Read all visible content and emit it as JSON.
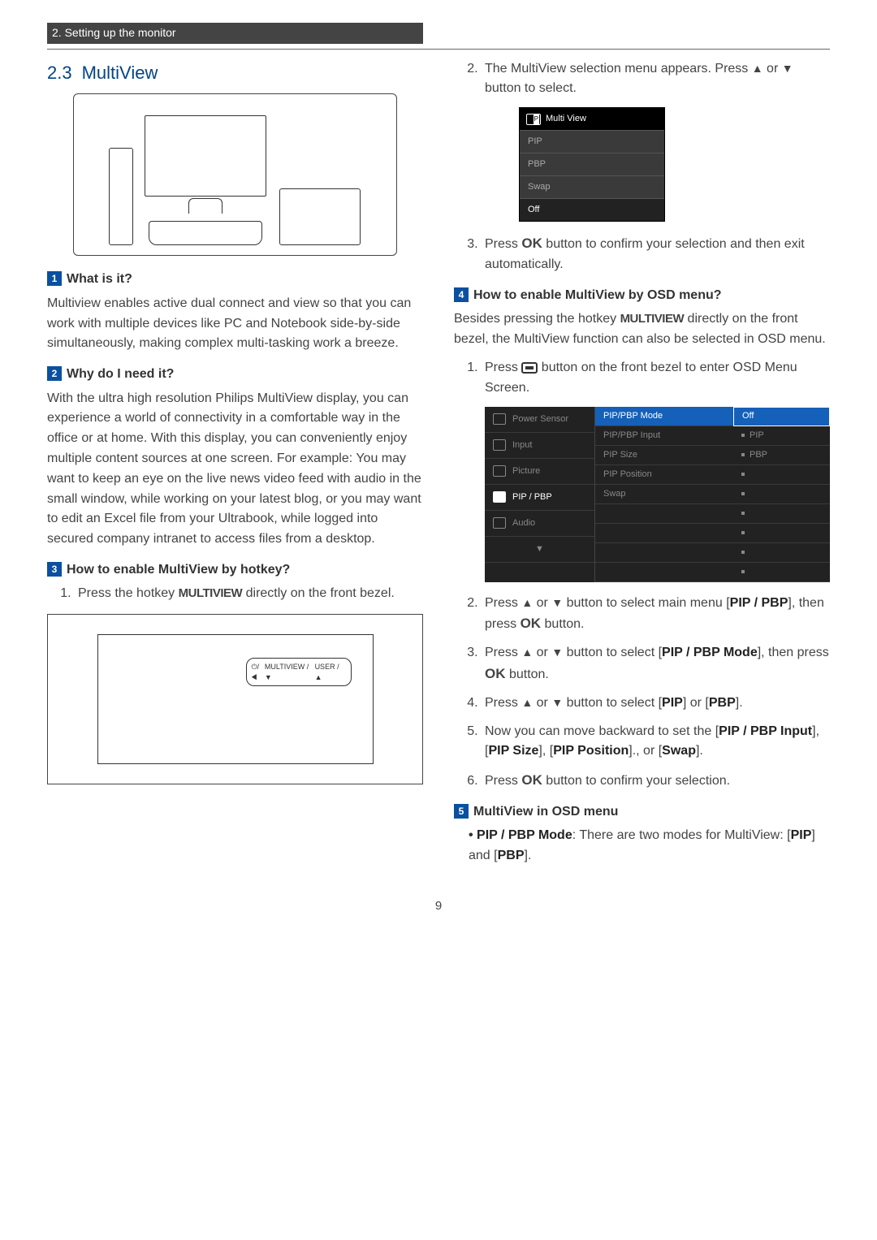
{
  "breadcrumb": {
    "num": "2.",
    "text": "Setting up the monitor"
  },
  "section": {
    "num": "2.3",
    "title": "MultiView"
  },
  "h1": {
    "num": "1",
    "title": "What is it?"
  },
  "p1": "Multiview enables active dual connect and view so that you can work with multiple devices like PC and Notebook side-by-side simultaneously, making complex multi-tasking work a breeze.",
  "h2": {
    "num": "2",
    "title": "Why do I need it?"
  },
  "p2": "With the ultra high resolution Philips MultiView display, you can experience a world of connectivity in a comfortable way in the office or at home. With this display, you can conveniently enjoy multiple content sources at one screen. For example: You may want to keep an eye on the live news video feed with audio in the small window, while working on your latest blog, or you may want to edit an Excel file from your Ultrabook, while logged into secured company intranet to access files from a desktop.",
  "h3": {
    "num": "3",
    "title": "How to enable MultiView by hotkey?"
  },
  "s3_1a": "Press the hotkey ",
  "s3_1b": " directly on the front bezel.",
  "multiview_label": "MULTIVIEW",
  "bezel_buttons": {
    "b1": "⏻/◀",
    "b2": "MULTIVIEW /▼",
    "b3": "USER /▲"
  },
  "s3_2a": "The MultiView selection menu appears. Press ",
  "up": "▲",
  "down": "▼",
  "s3_2b": " or ",
  "s3_2c": " button to select.",
  "mvmenu": {
    "title": "Multi View",
    "r1": "PIP",
    "r2": "PBP",
    "r3": "Swap",
    "r4": "Off"
  },
  "s3_3a": "Press ",
  "ok": "OK",
  "s3_3b": " button to confirm your selection and then exit automatically.",
  "h4": {
    "num": "4",
    "title": "How to enable MultiView by OSD menu?"
  },
  "p4a": "Besides pressing the hotkey ",
  "p4b": " directly on the front bezel,  the MultiView function can also be selected in OSD menu.",
  "s4_1a": "Press ",
  "s4_1b": " button on the front bezel to enter OSD Menu Screen.",
  "osd": {
    "left": [
      "Power Sensor",
      "Input",
      "Picture",
      "PIP / PBP",
      "Audio"
    ],
    "mid": [
      "PIP/PBP Mode",
      "PIP/PBP Input",
      "PIP Size",
      "PIP Position",
      "Swap"
    ],
    "right": [
      "Off",
      "PIP",
      "PBP"
    ]
  },
  "s4_2": {
    "a": "Press ",
    "b": " or ",
    "c": " button to select main menu [",
    "d": "PIP / PBP",
    "e": "], then press ",
    "f": " button."
  },
  "s4_3": {
    "a": "Press ",
    "b": " or ",
    "c": " button to select [",
    "d": "PIP / PBP Mode",
    "e": "], then press ",
    "f": " button."
  },
  "s4_4": {
    "a": "Press ",
    "b": " or ",
    "c": " button to select [",
    "d": "PIP",
    "e": "] or [",
    "f": "PBP",
    "g": "]."
  },
  "s4_5": {
    "a": "Now you can move backward to set the [",
    "b": "PIP / PBP Input",
    "c": "], [",
    "d": "PIP Size",
    "e": "], [",
    "f": "PIP Position",
    "g": "]., or [",
    "h": "Swap",
    "i": "]."
  },
  "s4_6": {
    "a": "Press ",
    "b": " button to confirm your selection."
  },
  "h5": {
    "num": "5",
    "title": "MultiView in OSD menu"
  },
  "b5_1": {
    "a": "PIP / PBP Mode",
    "b": ": There are two modes for MultiView: [",
    "c": "PIP",
    "d": "] and [",
    "e": "PBP",
    "f": "]."
  },
  "page_number": "9"
}
